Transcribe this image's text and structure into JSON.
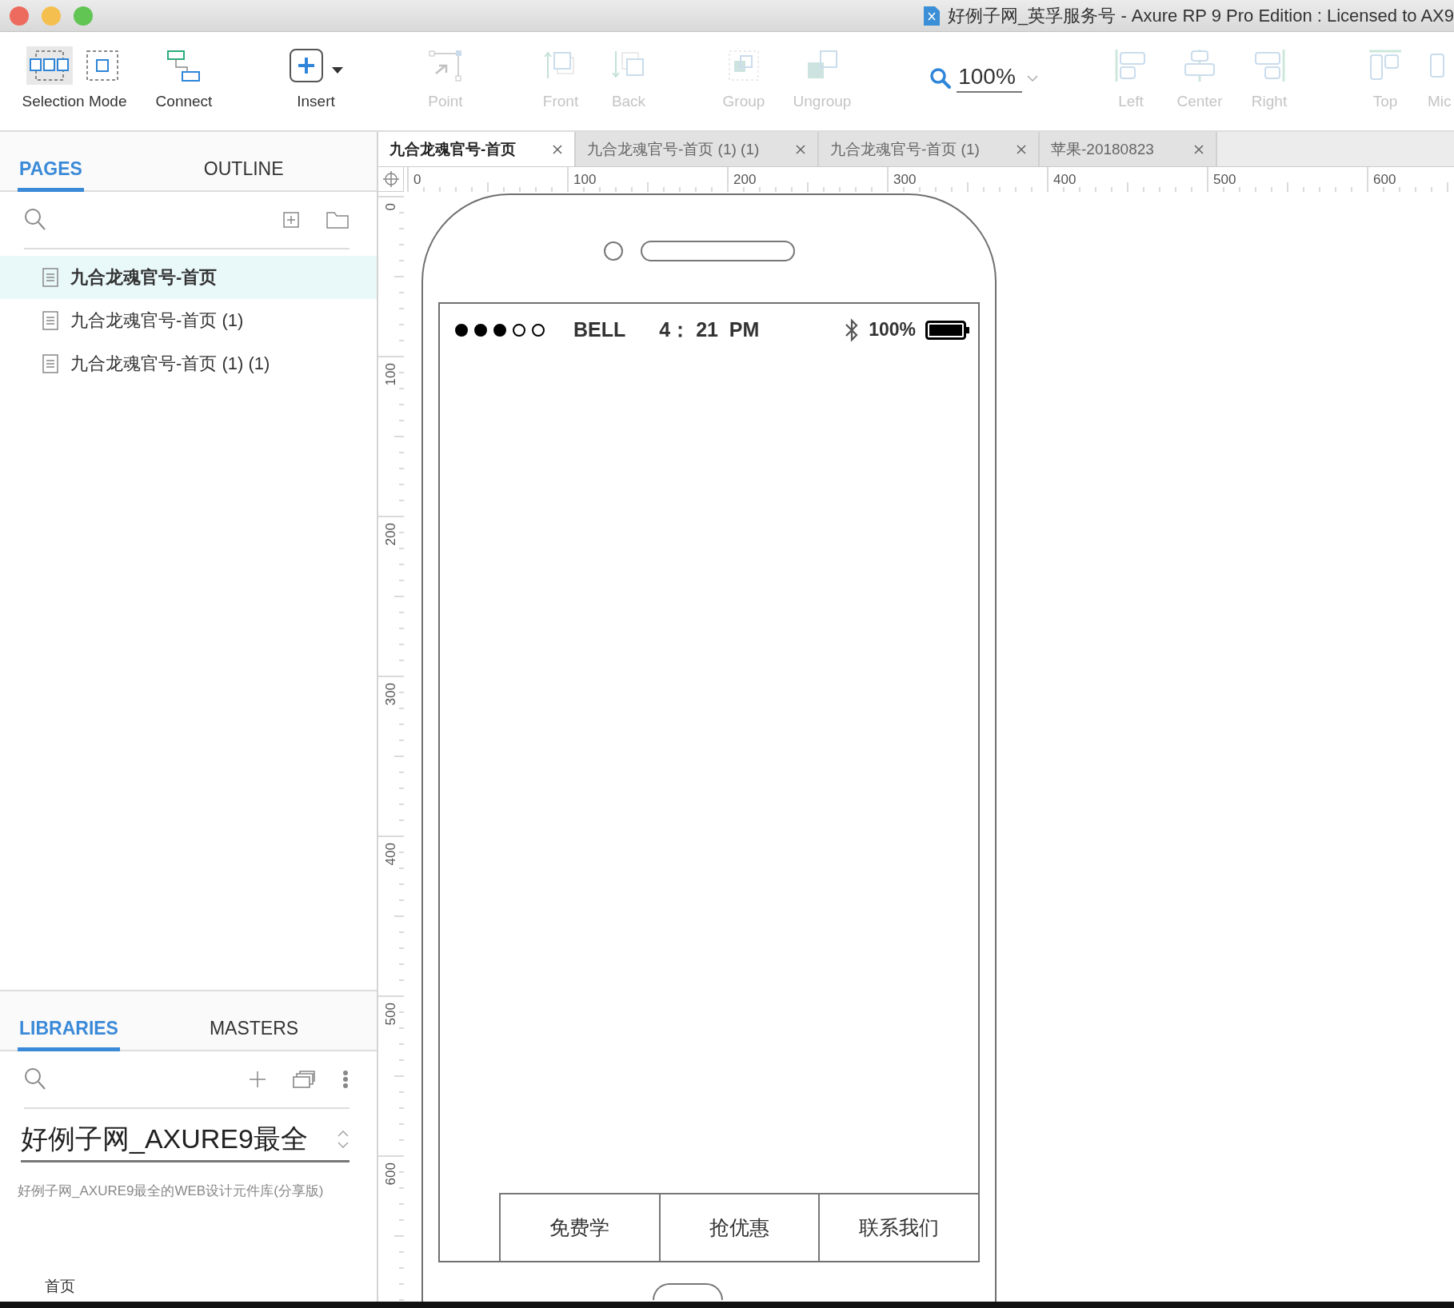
{
  "window": {
    "title": "好例子网_英孚服务号 - Axure RP 9 Pro Edition : Licensed to AX9"
  },
  "toolbar": [
    {
      "kind": "selection",
      "label": "Selection Mode",
      "modes": [
        {
          "kind": "intersect",
          "selected": true
        },
        {
          "kind": "contain",
          "selected": false
        }
      ]
    },
    {
      "kind": "connect",
      "label": "Connect",
      "disabled": false
    },
    {
      "kind": "insert",
      "label": "Insert",
      "disabled": false
    },
    {
      "kind": "point",
      "label": "Point",
      "disabled": true
    },
    {
      "kind": "front",
      "label": "Front",
      "disabled": true
    },
    {
      "kind": "back",
      "label": "Back",
      "disabled": true
    },
    {
      "kind": "group",
      "label": "Group",
      "disabled": true
    },
    {
      "kind": "ungroup",
      "label": "Ungroup",
      "disabled": true
    },
    {
      "kind": "zoom",
      "value": "100%"
    },
    {
      "kind": "left",
      "label": "Left",
      "disabled": true
    },
    {
      "kind": "center",
      "label": "Center",
      "disabled": true
    },
    {
      "kind": "right",
      "label": "Right",
      "disabled": true
    },
    {
      "kind": "top",
      "label": "Top",
      "disabled": true
    },
    {
      "kind": "middle",
      "label": "Mic",
      "disabled": true
    }
  ],
  "pages_panel": {
    "tabs": [
      {
        "label": "PAGES",
        "selected": true
      },
      {
        "label": "OUTLINE",
        "selected": false
      }
    ],
    "pages": [
      {
        "name": "九合龙魂官号-首页",
        "selected": true
      },
      {
        "name": "九合龙魂官号-首页 (1)",
        "selected": false
      },
      {
        "name": "九合龙魂官号-首页 (1) (1)",
        "selected": false
      }
    ]
  },
  "libraries_panel": {
    "tabs": [
      {
        "label": "LIBRARIES",
        "selected": true
      },
      {
        "label": "MASTERS",
        "selected": false
      }
    ],
    "library": "好例子网_AXURE9最全",
    "description": "好例子网_AXURE9最全的WEB设计元件库(分享版)",
    "footer": "首页"
  },
  "canvas": {
    "tabs": [
      {
        "label": "九合龙魂官号-首页",
        "selected": true
      },
      {
        "label": "九合龙魂官号-首页 (1) (1)",
        "selected": false
      },
      {
        "label": "九合龙魂官号-首页 (1)",
        "selected": false
      },
      {
        "label": "苹果-20180823",
        "selected": false
      }
    ],
    "ruler": {
      "horizontal": [
        "0",
        "100",
        "200",
        "300",
        "400",
        "500",
        "600"
      ],
      "vertical": [
        "0",
        "100",
        "200",
        "300",
        "400",
        "500",
        "600"
      ]
    },
    "phone": {
      "status_bar": {
        "signal": [
          {
            "filled": true
          },
          {
            "filled": true
          },
          {
            "filled": true
          },
          {
            "filled": false
          },
          {
            "filled": false
          }
        ],
        "carrier": "BELL",
        "time": "4： 21  PM",
        "battery": "100%"
      },
      "nav": [
        "免费学",
        "抢优惠",
        "联系我们"
      ]
    }
  }
}
